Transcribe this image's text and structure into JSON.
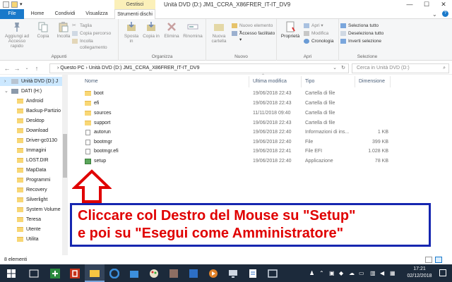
{
  "window": {
    "title": "Unità DVD (D:) JM1_CCRA_X86FRER_IT-IT_DV9",
    "contextual_group": "Gestisci",
    "controls": {
      "minimize": "—",
      "maximize": "☐",
      "close": "✕"
    }
  },
  "tabs": [
    {
      "label": "File"
    },
    {
      "label": "Home"
    },
    {
      "label": "Condividi"
    },
    {
      "label": "Visualizza"
    },
    {
      "label": "Strumenti dischi"
    }
  ],
  "ribbon": {
    "appunti": {
      "pin": "Aggiungi ad Accesso rapido",
      "copy": "Copia",
      "paste": "Incolla",
      "cut": "Taglia",
      "copy_path": "Copia percorso",
      "paste_link": "Incolla collegamento",
      "label": "Appunti"
    },
    "organizza": {
      "move": "Sposta in",
      "copy_to": "Copia in",
      "delete": "Elimina",
      "rename": "Rinomina",
      "label": "Organizza"
    },
    "nuovo": {
      "new_folder": "Nuova cartella",
      "new_item": "Nuovo elemento",
      "easy_access": "Accesso facilitato",
      "label": "Nuovo"
    },
    "apri": {
      "properties": "Proprietà",
      "open": "Apri",
      "edit": "Modifica",
      "history": "Cronologia",
      "label": "Apri"
    },
    "selezione": {
      "select_all": "Seleziona tutto",
      "select_none": "Deseleziona tutto",
      "invert": "Inverti selezione",
      "label": "Selezione"
    }
  },
  "address": {
    "path": "›   Questo PC   ›   Unità DVD (D:) JM1_CCRA_X86FRER_IT-IT_DV9",
    "search_placeholder": "Cerca in Unità DVD (D:)"
  },
  "nav": {
    "items": [
      "Unità DVD (D:) J",
      "DATI (H:)",
      "Android",
      "Backup-Partizio",
      "Desktop",
      "Download",
      "Driver-gc0130",
      "Immagini",
      "LOST.DIR",
      "MapData",
      "Programmi",
      "Recovery",
      "Silverlight",
      "System Volume",
      "Teresa",
      "Utente",
      "Utilita"
    ]
  },
  "columns": {
    "name": "Nome",
    "date": "Ultima modifica",
    "type": "Tipo",
    "size": "Dimensione"
  },
  "files": [
    {
      "name": "boot",
      "date": "19/06/2018 22:43",
      "type": "Cartella di file",
      "size": "",
      "icon": "folder-icon"
    },
    {
      "name": "efi",
      "date": "19/06/2018 22:43",
      "type": "Cartella di file",
      "size": "",
      "icon": "folder-icon"
    },
    {
      "name": "sources",
      "date": "11/11/2018 09:40",
      "type": "Cartella di file",
      "size": "",
      "icon": "folder-icon"
    },
    {
      "name": "support",
      "date": "19/06/2018 22:43",
      "type": "Cartella di file",
      "size": "",
      "icon": "folder-icon"
    },
    {
      "name": "autorun",
      "date": "19/06/2018 22:40",
      "type": "Informazioni di ins...",
      "size": "1 KB",
      "icon": "settings-file-icon"
    },
    {
      "name": "bootmgr",
      "date": "19/06/2018 22:40",
      "type": "File",
      "size": "399 KB",
      "icon": "file-icon"
    },
    {
      "name": "bootmgr.efi",
      "date": "19/06/2018 22:41",
      "type": "File EFI",
      "size": "1.028 KB",
      "icon": "file-icon"
    },
    {
      "name": "setup",
      "date": "19/06/2018 22:40",
      "type": "Applicazione",
      "size": "78 KB",
      "icon": "setup-app-icon"
    }
  ],
  "annotation": {
    "line1": "Cliccare col Destro del Mouse su \"Setup\"",
    "line2": "e poi su \"Esegui come Amministratore\""
  },
  "status": {
    "count": "8 elementi"
  },
  "taskbar": {
    "time": "17:21",
    "date": "02/12/2018"
  },
  "colors": {
    "accent": "#1979ca",
    "annotation_red": "#e00000",
    "annotation_border": "#1626b0",
    "taskbar": "#1c2a3b"
  }
}
